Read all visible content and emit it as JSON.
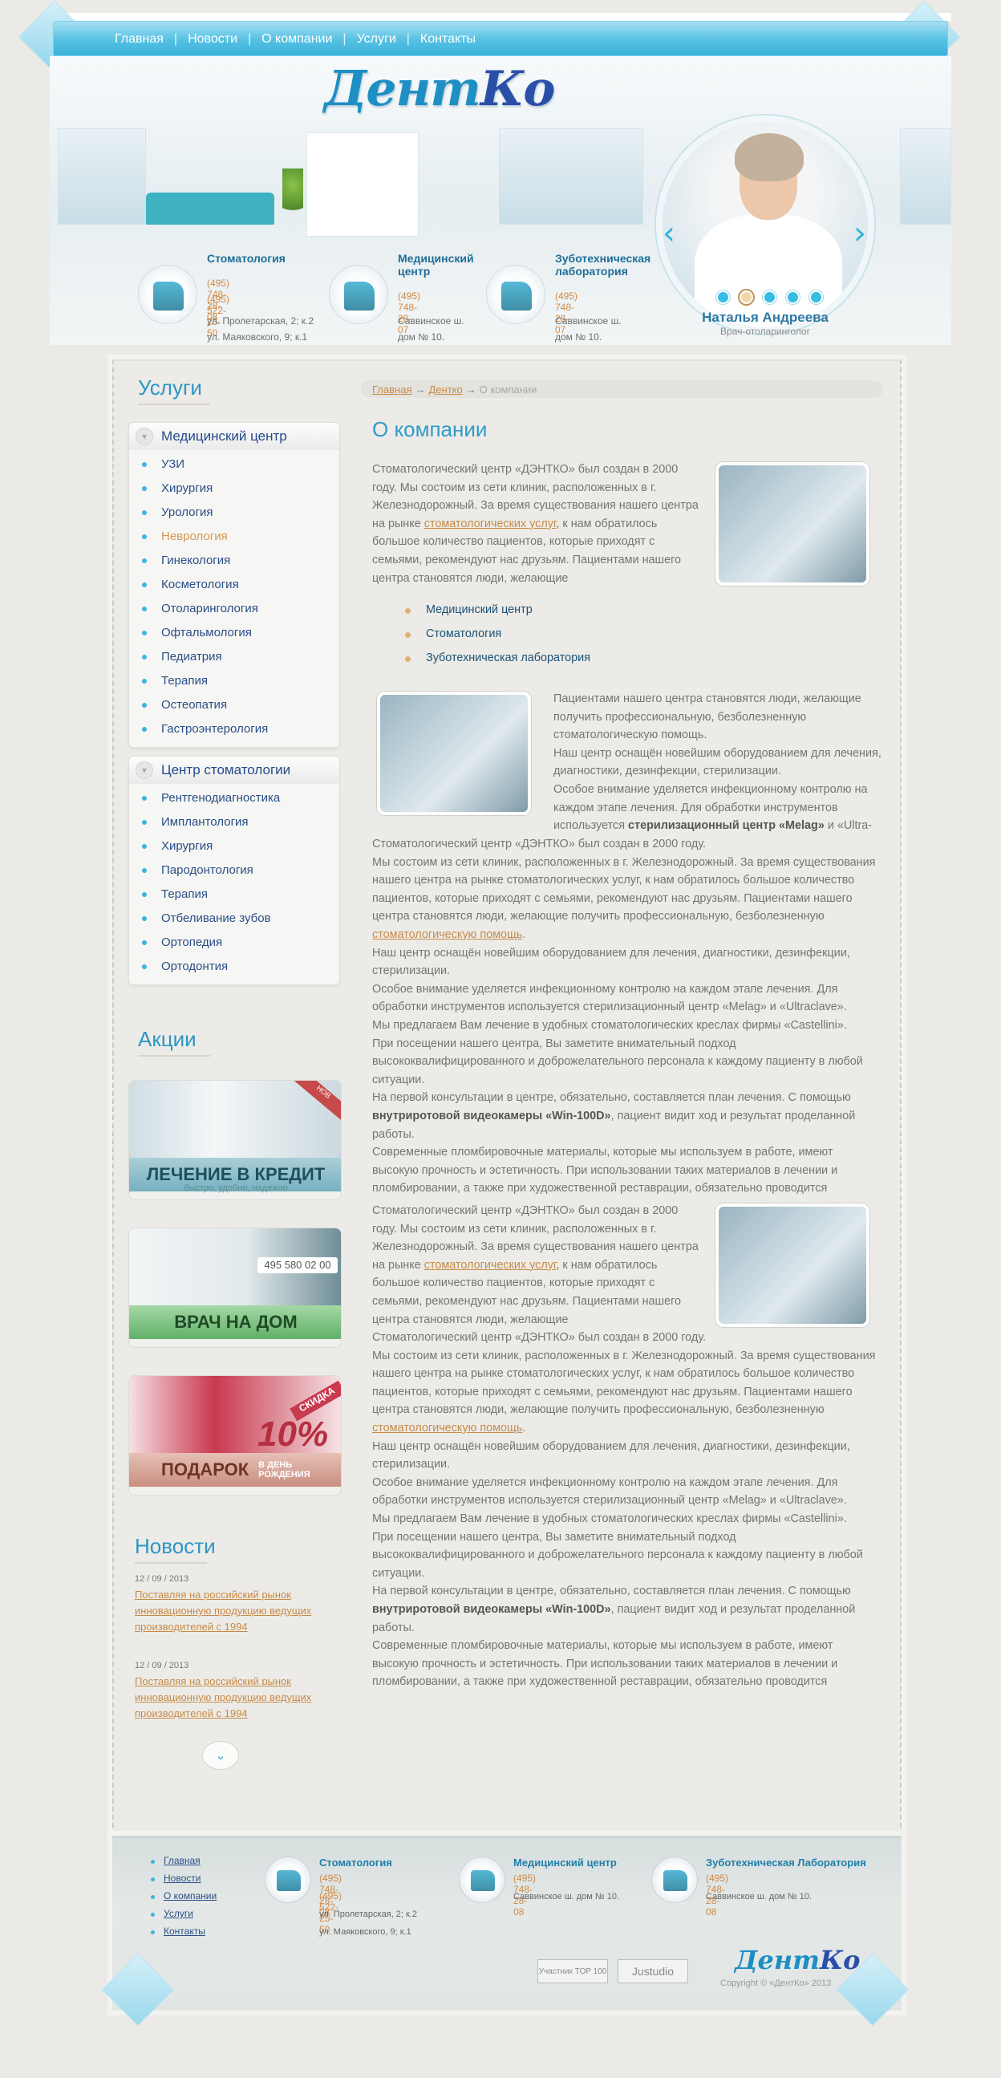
{
  "nav": [
    "Главная",
    "Новости",
    "О компании",
    "Услуги",
    "Контакты"
  ],
  "logo": {
    "part1": "Дент",
    "part2": "Ко"
  },
  "slider": {
    "name": "Наталья Андреева",
    "specialty": "Врач-отоларинголог",
    "prev_icon": "‹",
    "next_icon": "›",
    "active_dot": 1,
    "dot_count": 5
  },
  "header_blocks": [
    {
      "title": "Стоматология",
      "phones": [
        "(495) 748-28-08",
        "(495) 522-25-50"
      ],
      "address": [
        "ул. Пролетарская, 2; к.2",
        "ул. Маяковского, 9; к.1"
      ]
    },
    {
      "title": "Медицинский центр",
      "phones": [
        "(495) 748-28-07"
      ],
      "address": [
        "Саввинское ш.",
        "дом № 10."
      ]
    },
    {
      "title": "Зуботехническая лаборатория",
      "phones": [
        "(495) 748-28-07"
      ],
      "address": [
        "Саввинское ш.",
        "дом № 10."
      ]
    }
  ],
  "sidebar": {
    "services_title": "Услуги",
    "medical": {
      "title": "Медицинский центр",
      "items": [
        "УЗИ",
        "Хирургия",
        "Урология",
        "Неврология",
        "Гинекология",
        "Косметология",
        "Отоларингология",
        "Офтальмология",
        "Педиатрия",
        "Терапия",
        "Остеопатия",
        "Гастроэнтерология"
      ]
    },
    "dental": {
      "title": "Центр стоматологии",
      "items": [
        "Рентгенодиагностика",
        "Имплантология",
        "Хирургия",
        "Пародонтология",
        "Терапия",
        "Отбеливание зубов",
        "Ортопедия",
        "Ортодонтия"
      ]
    },
    "promo_title": "Акции",
    "promos": [
      {
        "label": "ЛЕЧЕНИЕ В КРЕДИТ",
        "sub": "быстро, удобно, надежно",
        "ribbon": "НОВ"
      },
      {
        "label": "ВРАЧ НА ДОМ",
        "phone": "495 580 02 00"
      },
      {
        "label": "ПОДАРОК",
        "tag": "СКИДКА",
        "percent": "10%",
        "note1": "В ДЕНЬ",
        "note2": "РОЖДЕНИЯ"
      }
    ],
    "news_title": "Новости",
    "news": [
      {
        "date": "12 / 09 / 2013",
        "text": "Поставляя на российский рынок инновационную продукцию ведущих производителей с 1994"
      },
      {
        "date": "12 / 09 / 2013",
        "text": "Поставляя на российский рынок инновационную продукцию ведущих производителей с 1994"
      }
    ],
    "scroll_icon": "⌄"
  },
  "breadcrumbs": {
    "items": [
      "Главная",
      "Дентко"
    ],
    "current": "О компании",
    "sep": "→"
  },
  "content": {
    "title": "О компании",
    "intro": "Стоматологический центр «ДЭНТКО» был создан в 2000 году. Мы состоим из сети клиник, расположенных в г. Железнодорожный. За время существования нашего центра на рынке ",
    "intro_link": "стоматологических услуг",
    "intro_end": ", к нам обратилось большое количество пациентов, которые приходят с семьями, рекомендуют нас друзьям. Пациентами нашего центра становятся люди, желающие",
    "bullets": [
      "Медицинский центр",
      "Стоматология",
      "Зуботехническая лаборатория"
    ],
    "p2_a": "Пациентами нашего центра становятся люди, желающие получить профессиональную, безболезненную стоматологическую помощь.",
    "p2_b": "Наш центр оснащён новейшим оборудованием для лечения, диагностики, дезинфекции, стерилизации.",
    "p2_c": "Особое внимание уделяется инфекционному контролю на каждом этапе лечения. Для обработки инструментов используется ",
    "p2_c_bold": "стерилизационный центр «Melag»",
    "p2_c_end": " и «Ultra-",
    "long1": "Стоматологический центр «ДЭНТКО» был создан в 2000 году.",
    "long2": "Мы состоим из сети клиник, расположенных в г. Железнодорожный. За время существования нашего центра на рынке стоматологических услуг, к нам обратилось большое количество пациентов, которые приходят с семьями, рекомендуют нас друзьям. Пациентами нашего центра становятся люди, желающие получить профессиональную, безболезненную ",
    "long2_link": "стоматологическую помощь",
    "long3": "Наш центр оснащён новейшим оборудованием для лечения, диагностики, дезинфекции, стерилизации.",
    "long4": "Особое внимание уделяется инфекционному контролю на каждом этапе лечения. Для обработки инструментов используется стерилизационный центр «Melag» и «Ultraclave».",
    "long5": "Мы предлагаем Вам лечение в удобных стоматологических креслах фирмы «Castellini».",
    "long6": "При посещении нашего центра, Вы заметите внимательный подход высококвалифицированного и доброжелательного персонала к каждому пациенту в любой ситуации.",
    "long7": "На первой консультации в центре, обязательно, составляется план лечения. С помощью ",
    "long7_bold": "внутриротовой видеокамеры «Win-100D»",
    "long7_end": ", пациент видит ход и результат проделанной работы.",
    "long8": "Современные пломбировочные материалы, которые мы используем в работе, имеют высокую прочность и эстетичность. При использовании таких материалов в лечении и пломбировании, а также при художественной реставрации, обязательно проводится"
  },
  "footer": {
    "nav": [
      "Главная",
      "Новости",
      "О компании",
      "Услуги",
      "Контакты"
    ],
    "blocks": [
      {
        "title": "Стоматология",
        "phones": [
          "(495) 748-28-08",
          "(495) 522-25-50"
        ],
        "address": [
          "ул. Пролетарская, 2; к.2",
          "ул. Маяковского, 9; к.1"
        ]
      },
      {
        "title": "Медицинский центр",
        "phones": [
          "(495) 748-28-08"
        ],
        "address": [
          "Саввинское ш. дом № 10."
        ]
      },
      {
        "title": "Зуботехническая Лаборатория",
        "phones": [
          "(495) 748-28-08"
        ],
        "address": [
          "Саввинское ш. дом № 10."
        ]
      }
    ],
    "badge1": "Участник TOP 100",
    "badge2": "Justudio",
    "copyright": "Copyright © «ДентКо» 2013"
  },
  "colors": {
    "accent": "#2f9bcb",
    "link": "#c88b47",
    "menu_text": "#2a4e86",
    "bullet": "#3db5db"
  }
}
